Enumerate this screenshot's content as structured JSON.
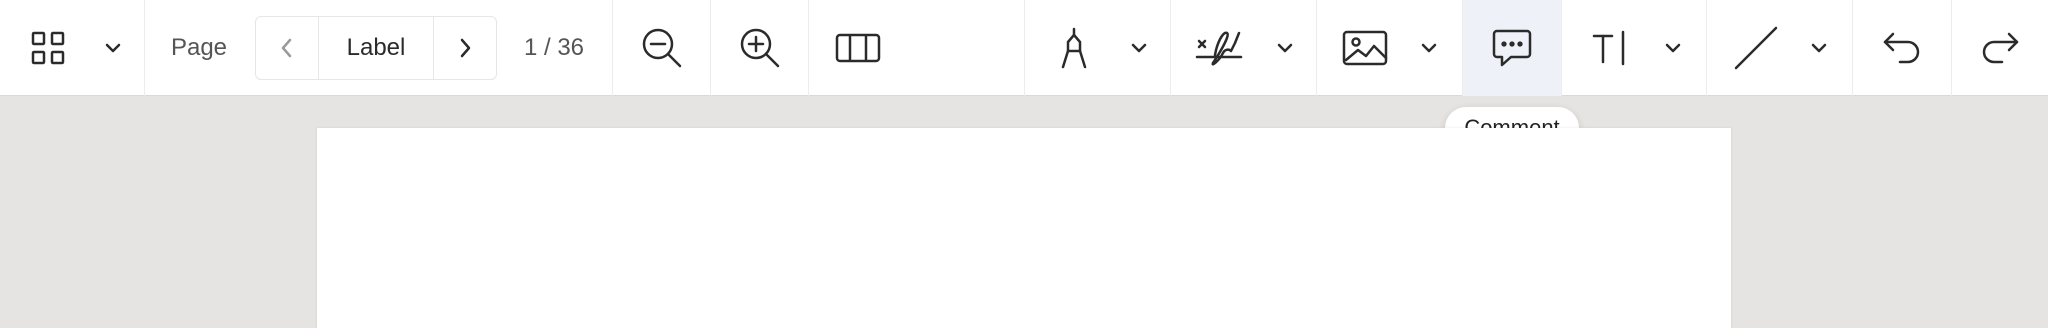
{
  "toolbar": {
    "page_label": "Page",
    "pager_value": "Label",
    "page_count": "1 / 36",
    "icons": {
      "grid": "grid-icon",
      "chevron_down": "chevron-down-icon",
      "chevron_left": "chevron-left-icon",
      "chevron_right": "chevron-right-icon",
      "zoom_out": "zoom-out-icon",
      "zoom_in": "zoom-in-icon",
      "columns": "columns-layout-icon",
      "pen": "pen-nib-icon",
      "signature": "signature-icon",
      "image": "image-icon",
      "comment": "comment-icon",
      "text": "text-cursor-icon",
      "line": "line-icon",
      "undo": "undo-icon",
      "redo": "redo-icon"
    },
    "active_tool": "comment",
    "active_color": "#eef1f8"
  },
  "tooltip": {
    "text": "Comment"
  }
}
